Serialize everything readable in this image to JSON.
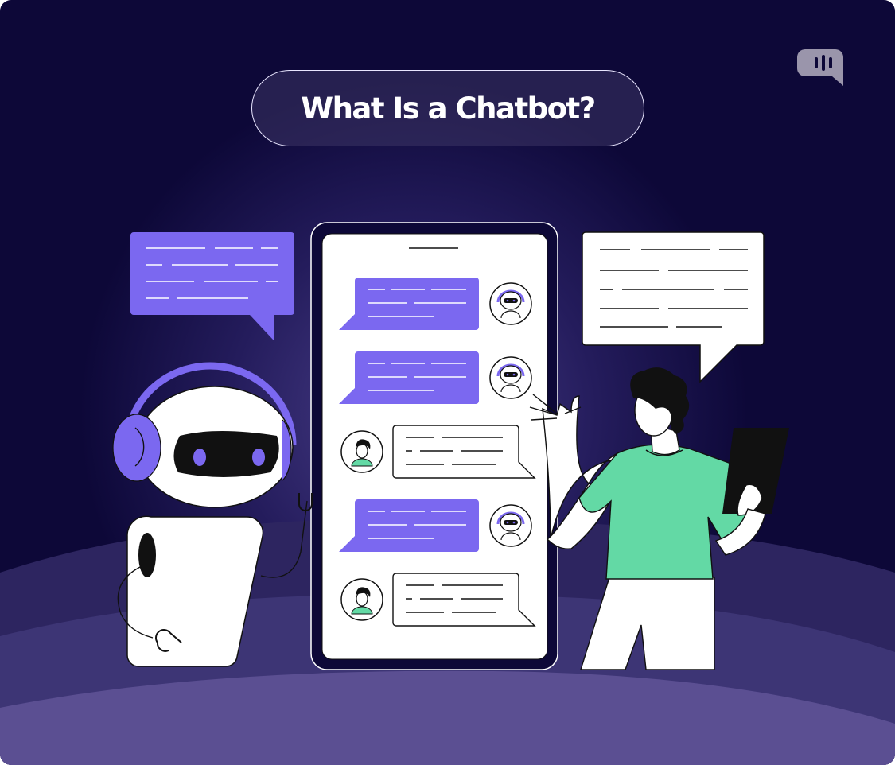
{
  "title": "What Is a Chatbot?",
  "logo_icon": "speech-bubble-soundwave-icon",
  "colors": {
    "background_top": "#0d0838",
    "background_glow": "#4a3f8a",
    "accent_purple": "#7b68f0",
    "shirt_green": "#63d9a5",
    "hill_back": "#2d2560",
    "hill_mid": "#3d3575",
    "hill_front": "#5b4f92"
  },
  "phone": {
    "messages": [
      {
        "sender": "bot",
        "avatar_icon": "robot-avatar-icon"
      },
      {
        "sender": "bot",
        "avatar_icon": "robot-avatar-icon"
      },
      {
        "sender": "user",
        "avatar_icon": "user-avatar-icon"
      },
      {
        "sender": "bot",
        "avatar_icon": "robot-avatar-icon"
      },
      {
        "sender": "user",
        "avatar_icon": "user-avatar-icon"
      }
    ]
  }
}
